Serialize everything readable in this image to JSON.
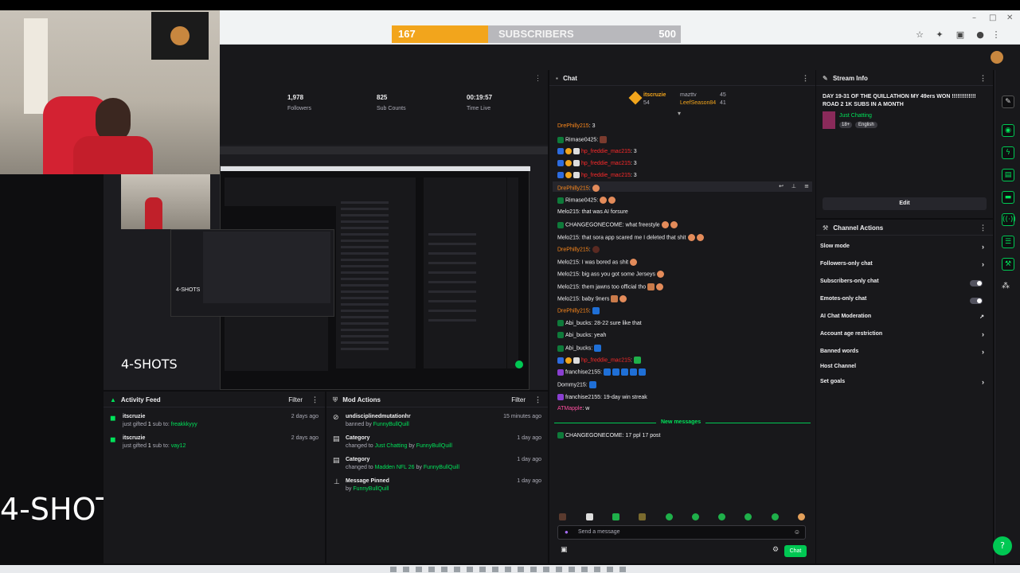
{
  "browser": {
    "subscribers_current": "167",
    "subscribers_label": "SUBSCRIBERS",
    "subscribers_goal": "500",
    "subscribers_progress": 0.334,
    "accent": "#f2a51c"
  },
  "stats": [
    {
      "value": "1,978",
      "label": "Followers"
    },
    {
      "value": "825",
      "label": "Sub Counts"
    },
    {
      "value": "00:19:57",
      "label": "Time Live"
    }
  ],
  "overlay": {
    "preview_label": "4-SHOTS",
    "big_label": "4-SHOTS",
    "nested_label": "4-SHOTS"
  },
  "activity_feed": {
    "title": "Activity Feed",
    "filter": "Filter",
    "items": [
      {
        "name": "itscruzie",
        "pre": "just gifted ",
        "num": "1",
        "mid": " sub to: ",
        "target": "freakkkyyy",
        "time": "2 days ago"
      },
      {
        "name": "itscruzie",
        "pre": "just gifted ",
        "num": "1",
        "mid": " sub to: ",
        "target": "vay12",
        "time": "2 days ago"
      }
    ]
  },
  "mod_actions": {
    "title": "Mod Actions",
    "filter": "Filter",
    "items": [
      {
        "title": "undisciplinedmutationhr",
        "pre": "banned by ",
        "by": "FunnyBullQuill",
        "time": "15 minutes ago",
        "icon": "ban-icon"
      },
      {
        "title": "Category",
        "pre": "changed to ",
        "target": "Just Chatting",
        "mid": " by ",
        "by": "FunnyBullQuill",
        "time": "1 day ago",
        "icon": "category-icon"
      },
      {
        "title": "Category",
        "pre": "changed to ",
        "target": "Madden NFL 26",
        "mid": " by ",
        "by": "FunnyBullQuill",
        "time": "1 day ago",
        "icon": "category-icon"
      },
      {
        "title": "Message Pinned",
        "pre": "by ",
        "by": "FunnyBullQuill",
        "time": "1 day ago",
        "icon": "pin-icon"
      }
    ]
  },
  "chat": {
    "title": "Chat",
    "top_gifter": "itscruzie",
    "top_gifter_count": "54",
    "leaders": [
      {
        "name": "mazttv",
        "count": "45"
      },
      {
        "name": "LeefSeason84",
        "count": "41"
      }
    ],
    "lines": [
      {
        "user": "DrePhilly215",
        "color": "orange",
        "text": ": 3"
      },
      {
        "user": "Rimase0425",
        "color": "white",
        "text": ":"
      },
      {
        "user": "hp_freddie_mac215",
        "color": "red",
        "text": ": 3"
      },
      {
        "user": "hp_freddie_mac215",
        "color": "red",
        "text": ": 3"
      },
      {
        "user": "hp_freddie_mac215",
        "color": "red",
        "text": ": 3"
      },
      {
        "user": "DrePhilly215",
        "color": "orange",
        "text": ":"
      },
      {
        "user": "Rimase0425",
        "color": "white",
        "text": ":"
      },
      {
        "user": "Melo215",
        "color": "white",
        "text": ": that was AI forsure"
      },
      {
        "user": "CHANGEGONECOME",
        "color": "white",
        "text": ": what freestyle"
      },
      {
        "user": "Melo215",
        "color": "white",
        "text": ": that sora app scared me I deleted that shit"
      },
      {
        "user": "DrePhilly215",
        "color": "orange",
        "text": ":"
      },
      {
        "user": "Melo215",
        "color": "white",
        "text": ": I was bored as shit"
      },
      {
        "user": "Melo215",
        "color": "white",
        "text": ": big ass you got some Jerseys"
      },
      {
        "user": "Melo215",
        "color": "white",
        "text": ": them jawns too official tho"
      },
      {
        "user": "Melo215",
        "color": "white",
        "text": ": baby 9ners"
      },
      {
        "user": "DrePhilly215",
        "color": "orange",
        "text": ":"
      },
      {
        "user": "Abi_bucks",
        "color": "white",
        "text": ": 28-22 sure like that"
      },
      {
        "user": "Abi_bucks",
        "color": "white",
        "text": ": yeah"
      },
      {
        "user": "Abi_bucks",
        "color": "white",
        "text": ":"
      },
      {
        "user": "hp_freddie_mac215",
        "color": "red",
        "text": ":"
      },
      {
        "user": "franchise2155",
        "color": "white",
        "text": ":"
      },
      {
        "user": "Dommy215",
        "color": "white",
        "text": ":"
      },
      {
        "user": "franchise2155",
        "color": "white",
        "text": ": 19-day win streak"
      },
      {
        "user": "ATMapple",
        "color": "pink",
        "text": ": w"
      }
    ],
    "new_messages": "New messages",
    "last_line": {
      "user": "CHANGEGONECOME",
      "text": ": 17 ppl 17 post"
    },
    "input_placeholder": "Send a message",
    "send_label": "Chat"
  },
  "stream_info": {
    "title": "Stream Info",
    "stream_title": "DAY 19-31 OF THE QUILLATHON MY 49ers WON !!!!!!!!!!!!! ROAD 2 1K SUBS IN A MONTH",
    "category": "Just Chatting",
    "tags": [
      "18+",
      "English"
    ],
    "edit_label": "Edit"
  },
  "channel_actions": {
    "title": "Channel Actions",
    "items": [
      {
        "label": "Slow mode",
        "control": "chevron"
      },
      {
        "label": "Followers-only chat",
        "control": "chevron"
      },
      {
        "label": "Subscribers-only chat",
        "control": "toggle"
      },
      {
        "label": "Emotes-only chat",
        "control": "toggle"
      },
      {
        "label": "AI Chat Moderation",
        "control": "external"
      },
      {
        "label": "Account age restriction",
        "control": "chevron"
      },
      {
        "label": "Banned words",
        "control": "chevron"
      },
      {
        "label": "Host Channel",
        "control": "none"
      },
      {
        "label": "Set goals",
        "control": "chevron"
      }
    ]
  }
}
